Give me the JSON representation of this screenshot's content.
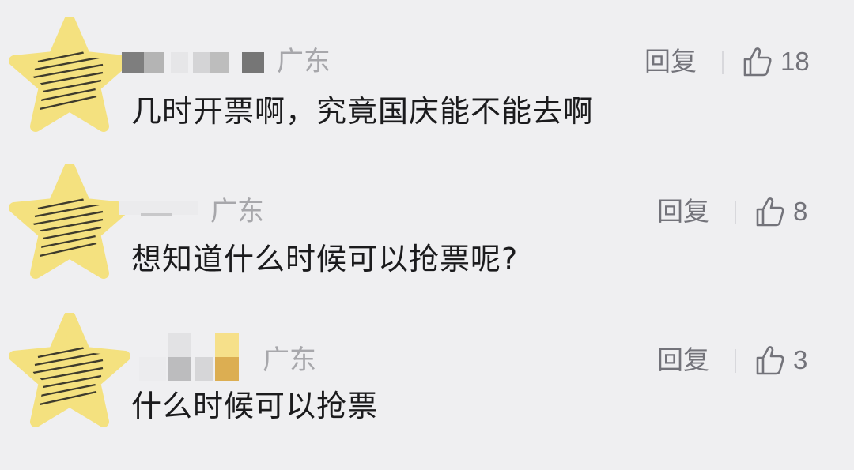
{
  "colors": {
    "background": "#efeff1",
    "avatar_star": "#f4e17f",
    "avatar_hatch": "#1e1e1e",
    "censor_gray_dark": "#7e7e7e",
    "censor_gray_mid": "#b9b9b9",
    "censor_gray_light": "#dcdcdc",
    "censor_yellow": "#f6e08a",
    "censor_orange": "#dcae52"
  },
  "comments": [
    {
      "location": "广东",
      "reply_label": "回复",
      "like_icon": "thumbs-up-icon",
      "like_count": "18",
      "text": "几时开票啊，究竟国庆能不能去啊"
    },
    {
      "location": "广东",
      "reply_label": "回复",
      "like_icon": "thumbs-up-icon",
      "like_count": "8",
      "text": "想知道什么时候可以抢票呢?"
    },
    {
      "location": "广东",
      "reply_label": "回复",
      "like_icon": "thumbs-up-icon",
      "like_count": "3",
      "text": "什么时候可以抢票"
    }
  ]
}
